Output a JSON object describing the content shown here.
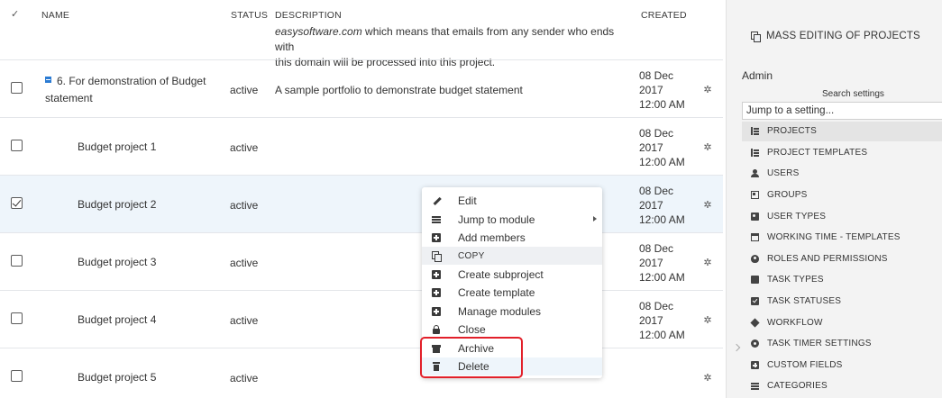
{
  "table": {
    "headers": {
      "check": "✓",
      "name": "NAME",
      "status": "STATUS",
      "description": "DESCRIPTION",
      "created": "CREATED"
    },
    "prev_description": {
      "italic": "easysoftware.com",
      "rest_line1": " which means that emails from any sender who ends with",
      "line2": "this domain will be processed into this project."
    },
    "rows": [
      {
        "checked": false,
        "expandable": true,
        "name_line1": "6. For demonstration of Budget",
        "name_line2": "statement",
        "status": "active",
        "description": "A sample portfolio to demonstrate budget statement",
        "created_date": "08 Dec",
        "created_year": "2017",
        "created_time": "12:00 AM"
      },
      {
        "checked": false,
        "expandable": false,
        "name_line1": "Budget project 1",
        "name_line2": "",
        "status": "active",
        "description": "",
        "created_date": "08 Dec",
        "created_year": "2017",
        "created_time": "12:00 AM"
      },
      {
        "checked": true,
        "expandable": false,
        "name_line1": "Budget project 2",
        "name_line2": "",
        "status": "active",
        "description": "",
        "created_date": "08 Dec",
        "created_year": "2017",
        "created_time": "12:00 AM"
      },
      {
        "checked": false,
        "expandable": false,
        "name_line1": "Budget project 3",
        "name_line2": "",
        "status": "active",
        "description": "",
        "created_date": "08 Dec",
        "created_year": "2017",
        "created_time": "12:00 AM"
      },
      {
        "checked": false,
        "expandable": false,
        "name_line1": "Budget project 4",
        "name_line2": "",
        "status": "active",
        "description": "",
        "created_date": "08 Dec",
        "created_year": "2017",
        "created_time": "12:00 AM"
      },
      {
        "checked": false,
        "expandable": false,
        "name_line1": "Budget project 5",
        "name_line2": "",
        "status": "active",
        "description": "",
        "created_date": "",
        "created_year": "",
        "created_time": ""
      }
    ],
    "row_action_icon": "gear-icon"
  },
  "context_menu": {
    "items": [
      {
        "label": "Edit",
        "icon": "pencil-icon"
      },
      {
        "label": "Jump to module",
        "icon": "list-icon",
        "submenu": true
      },
      {
        "label": "Add members",
        "icon": "plus-square-icon"
      },
      {
        "label": "COPY",
        "icon": "copy-icon"
      },
      {
        "label": "Create subproject",
        "icon": "plus-square-icon"
      },
      {
        "label": "Create template",
        "icon": "plus-square-icon"
      },
      {
        "label": "Manage modules",
        "icon": "plus-square-icon"
      },
      {
        "label": "Close",
        "icon": "lock-icon"
      },
      {
        "label": "Archive",
        "icon": "archive-icon"
      },
      {
        "label": "Delete",
        "icon": "trash-icon"
      }
    ],
    "highlight_color": "#e2202a"
  },
  "sidebar": {
    "mass_editing": "MASS EDITING OF PROJECTS",
    "section_title": "Admin",
    "search_label": "Search settings",
    "search_placeholder": "Jump to a setting...",
    "items": [
      {
        "label": "PROJECTS",
        "icon": "tree-icon",
        "active": true
      },
      {
        "label": "PROJECT TEMPLATES",
        "icon": "tree-icon"
      },
      {
        "label": "USERS",
        "icon": "user-icon"
      },
      {
        "label": "GROUPS",
        "icon": "group-icon"
      },
      {
        "label": "USER TYPES",
        "icon": "id-card-icon"
      },
      {
        "label": "WORKING TIME - TEMPLATES",
        "icon": "calendar-icon"
      },
      {
        "label": "ROLES AND PERMISSIONS",
        "icon": "shield-icon"
      },
      {
        "label": "TASK TYPES",
        "icon": "box-icon"
      },
      {
        "label": "TASK STATUSES",
        "icon": "checkbox-icon"
      },
      {
        "label": "WORKFLOW",
        "icon": "diamond-icon"
      },
      {
        "label": "TASK TIMER SETTINGS",
        "icon": "gear-icon"
      },
      {
        "label": "CUSTOM FIELDS",
        "icon": "plus-square-icon"
      },
      {
        "label": "CATEGORIES",
        "icon": "list-icon"
      }
    ]
  }
}
